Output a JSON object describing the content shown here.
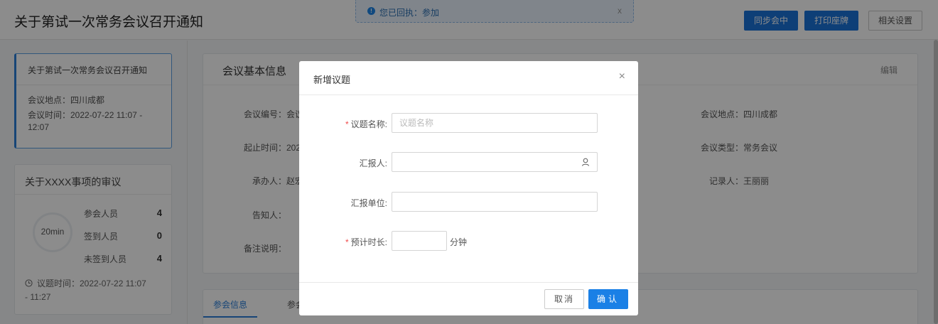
{
  "header": {
    "title": "关于第试一次常务会议召开通知",
    "notice": {
      "text": "您已回执：参加",
      "close": "x",
      "icon": "info-icon"
    },
    "buttons": {
      "sync": "同步会中",
      "print": "打印座牌",
      "settings": "相关设置"
    }
  },
  "left": {
    "meeting_card": {
      "title": "关于第试一次常务会议召开通知",
      "location": "会议地点：四川成都",
      "time_line1": "会议时间：2022-07-22 11:07 -",
      "time_line2": "12:07"
    },
    "topic_card": {
      "title": "关于XXXX事项的审议",
      "duration": "20min",
      "stats": [
        {
          "label": "参会人员",
          "value": "4"
        },
        {
          "label": "签到人员",
          "value": "0"
        },
        {
          "label": "未签到人员",
          "value": "4"
        }
      ],
      "topic_time_line1": "议题时间：2022-07-22 11:07",
      "topic_time_line2": "- 11:27",
      "clock_icon": "clock-icon"
    }
  },
  "main": {
    "basic_info": {
      "title": "会议基本信息",
      "edit": "编辑",
      "fields": {
        "number": "会议编号：会议",
        "start_end": "起止时间：202",
        "organizer": "承办人：赵宏",
        "notify": "告知人：",
        "remark": "备注说明：",
        "location": "会议地点：四川成都",
        "type": "会议类型：常务会议",
        "recorder": "记录人：王丽丽"
      }
    },
    "tabs": [
      "参会信息",
      "参会"
    ]
  },
  "modal": {
    "title": "新增议题",
    "close": "×",
    "fields": {
      "topic_name": {
        "label": "议题名称:",
        "required": true,
        "placeholder": "议题名称",
        "value": ""
      },
      "reporter": {
        "label": "汇报人:",
        "required": false,
        "value": "",
        "icon": "user-icon"
      },
      "report_unit": {
        "label": "汇报单位:",
        "required": false,
        "value": ""
      },
      "duration": {
        "label": "预计时长:",
        "required": true,
        "value": "",
        "unit": "分钟"
      }
    },
    "buttons": {
      "cancel": "取消",
      "ok": "确认"
    }
  }
}
